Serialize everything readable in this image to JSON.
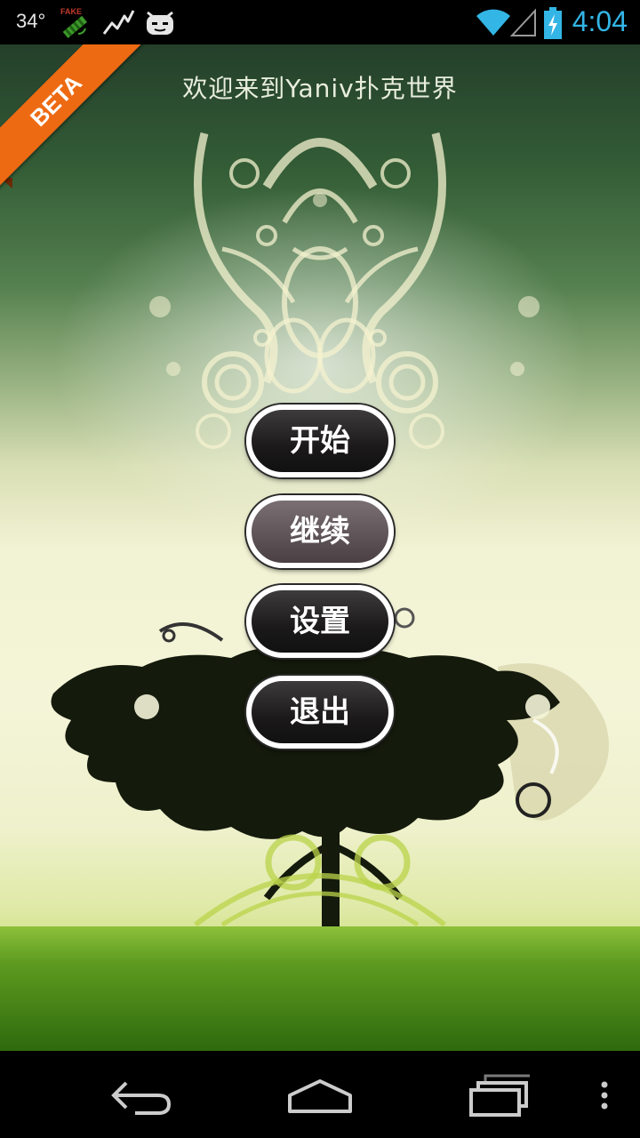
{
  "status_bar": {
    "temperature": "34°",
    "time": "4:04",
    "icons": [
      "fake-gps-icon",
      "activity-graph-icon",
      "cyanogen-android-icon",
      "wifi-icon",
      "signal-icon",
      "battery-charging-icon"
    ]
  },
  "app": {
    "title": "欢迎来到Yaniv扑克世界",
    "ribbon": "BETA"
  },
  "menu": {
    "start": "开始",
    "continue": "继续",
    "settings": "设置",
    "exit": "退出"
  },
  "nav_bar": {
    "icons": [
      "back-icon",
      "home-icon",
      "recent-apps-icon",
      "overflow-menu-icon"
    ]
  },
  "colors": {
    "accent_clock": "#33b5e5",
    "ribbon": "#ee6a12",
    "button_dark": "#1b191a",
    "button_disabled": "#5d5256",
    "grass": "#4a8a18"
  }
}
